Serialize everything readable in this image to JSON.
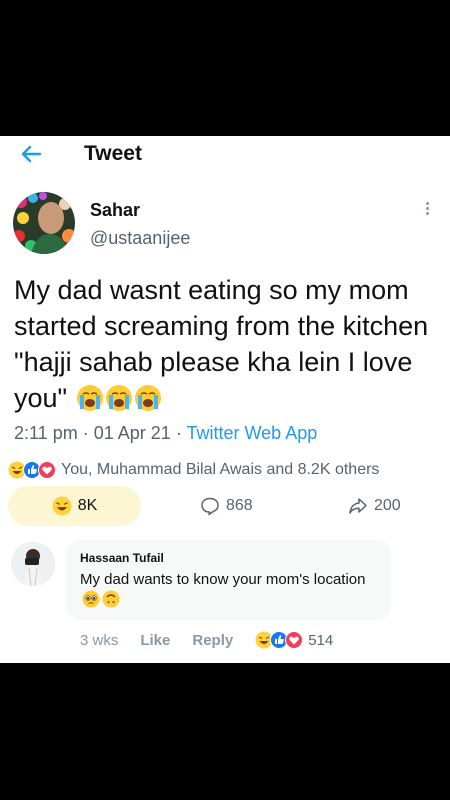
{
  "header": {
    "title": "Tweet"
  },
  "tweet": {
    "author_name": "Sahar",
    "author_handle": "@ustaanijee",
    "text": "My dad wasnt eating so my mom started screaming from the kitchen \"hajji sahab please kha lein I love you\"",
    "text_emojis": [
      "loudly-crying-face",
      "loudly-crying-face",
      "loudly-crying-face"
    ],
    "time": "2:11 pm",
    "date": "01 Apr 21",
    "separator": "·",
    "source": "Twitter Web App",
    "reactions_icons": [
      "laugh-reaction",
      "like-reaction",
      "love-reaction"
    ],
    "reactions_text": "You, Muhammad Bilal Awais and 8.2K others",
    "laugh_count": "8K",
    "reply_count": "868",
    "share_count": "200"
  },
  "reply": {
    "author_name": "Hassaan Tufail",
    "text": "My dad wants to know your mom's location",
    "text_emojis": [
      "pleading-face",
      "upside-down-face"
    ],
    "time": "3 wks",
    "like_label": "Like",
    "reply_label": "Reply",
    "reactions_icons": [
      "laugh-reaction",
      "like-reaction",
      "love-reaction"
    ],
    "reaction_count": "514"
  },
  "colors": {
    "accent": "#1d9bf0",
    "secondary_text": "#536471",
    "laugh_pill_bg": "#fdf6d3",
    "reply_bubble_bg": "#f7f9f9"
  }
}
